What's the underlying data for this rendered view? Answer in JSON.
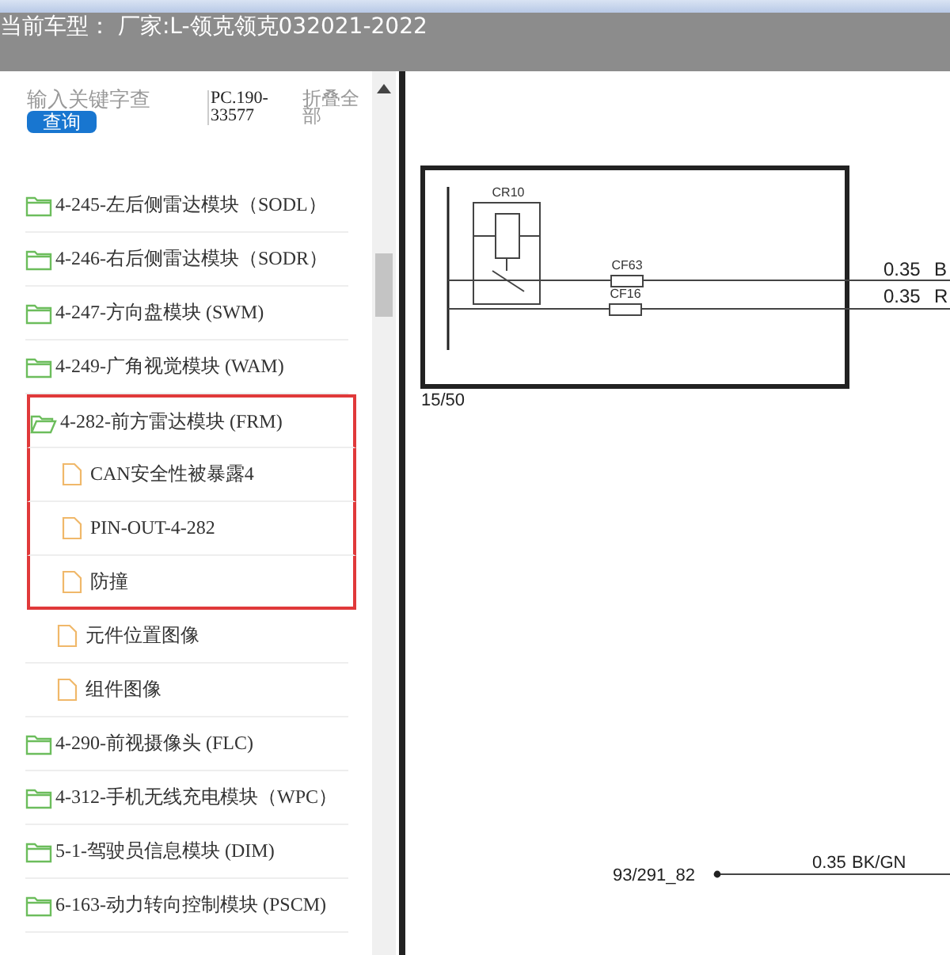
{
  "header": {
    "title": "当前车型： 厂家:L-领克领克032021-2022"
  },
  "search": {
    "placeholder": "输入关键字查",
    "button": "查询",
    "part_number": "PC.190-33577",
    "collapse_all": "折叠全部"
  },
  "tree": [
    {
      "label": "4-245-左后侧雷达模块（SODL）",
      "expanded": false,
      "highlighted": false
    },
    {
      "label": "4-246-右后侧雷达模块（SODR）",
      "expanded": false,
      "highlighted": false
    },
    {
      "label": "4-247-方向盘模块 (SWM)",
      "expanded": false,
      "highlighted": false
    },
    {
      "label": "4-249-广角视觉模块 (WAM)",
      "expanded": false,
      "highlighted": false
    },
    {
      "label": "4-282-前方雷达模块 (FRM)",
      "expanded": true,
      "highlighted": true,
      "children": [
        {
          "label": "CAN安全性被暴露4",
          "highlighted": true
        },
        {
          "label": "PIN-OUT-4-282",
          "highlighted": true
        },
        {
          "label": "防撞",
          "highlighted": true
        },
        {
          "label": "元件位置图像",
          "highlighted": false
        },
        {
          "label": "组件图像",
          "highlighted": false
        }
      ]
    },
    {
      "label": "4-290-前视摄像头 (FLC)",
      "expanded": false,
      "highlighted": false
    },
    {
      "label": "4-312-手机无线充电模块（WPC）",
      "expanded": false,
      "highlighted": false
    },
    {
      "label": "5-1-驾驶员信息模块 (DIM)",
      "expanded": false,
      "highlighted": false
    },
    {
      "label": "6-163-动力转向控制模块 (PSCM)",
      "expanded": false,
      "highlighted": false
    }
  ],
  "diagram": {
    "relay": "CR10",
    "fuses": [
      "CF63",
      "CF16"
    ],
    "wires": [
      {
        "size": "0.35",
        "color_code": "B"
      },
      {
        "size": "0.35",
        "color_code": "R"
      }
    ],
    "terminal": "15/50",
    "bottom_wire": {
      "connector": "93/291_82",
      "size": "0.35",
      "color_code": "BK/GN"
    }
  }
}
